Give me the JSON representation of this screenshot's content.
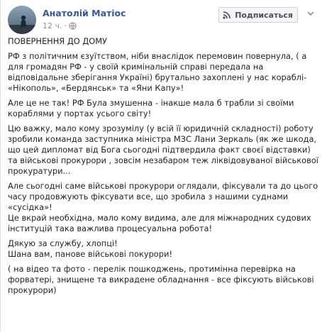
{
  "post": {
    "author": "Анатолій Матіос",
    "time": "12 ч.",
    "separator": "·",
    "subscribe_label": "Подписаться",
    "icons": {
      "avatar": "author-avatar",
      "privacy": "globe-icon",
      "subscribe": "rss-icon",
      "menu": "chevron-down-icon"
    },
    "colors": {
      "author": "#365899",
      "meta": "#90949c",
      "text": "#1d2129"
    },
    "paragraphs": [
      "ПОВЕРНЕННЯ ДО ДОМУ",
      "РФ з політичним єзуїтством, ніби внаслідок перемовин повернула, ( а для громадян РФ - у своїй кримінальній справі передала на відповідальне зберігання Україні) брутально захоплені у нас кораблі- «Нікополь», «Бердянськ» та «Яни Капу»!",
      "Але це не так! РФ Була змушенна - інакше мала б трабли зі своїми кораблями у портах усього світу!",
      "Цю важку, мало кому зрозумілу (у всій її юридичній складності) роботу зробили команда заступника міністра МЗС Лани Зеркаль (як же шкода, що цей дипломат від Бога сьогодні підтвердила факт своєї відставки) та військові прокурори , зовсім незабаром теж ліквідовуваної військової прокуратури...",
      "Але сьогодні саме військові прокурори оглядали, фіксували та до цього часу продовжують фіксувати все, що зробила з нашими суднами «сусідка»!",
      "Це вкрай необхідна, мало кому видима, але для міжнародних судових інституцій така важлива процесуальна робота!",
      "Дякую за службу, хлопці!",
      "Шана вам, панове військові покурори!",
      "( на відео та фото - перелік пошкоджень, протимінна перевірка на форватері, знищене та викрадене обладнання - все фіксують військові прокурори)"
    ]
  }
}
